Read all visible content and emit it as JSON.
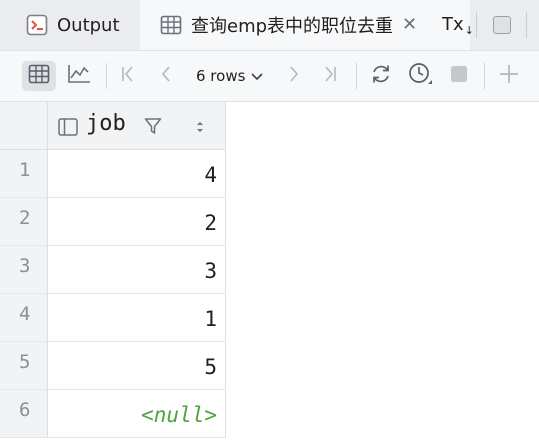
{
  "tabs": [
    {
      "label": "Output",
      "icon": "output-console-icon"
    },
    {
      "label": "查询emp表中的职位去重",
      "icon": "table-grid-icon",
      "active": true
    },
    {
      "label": "Tx",
      "sub": "↓",
      "icon": "transaction-icon"
    }
  ],
  "toolbar": {
    "rows_label": "6 rows",
    "buttons": [
      "grid-view-icon",
      "chart-view-icon",
      "first-page-icon",
      "prev-page-icon",
      "rows-dropdown",
      "next-page-icon",
      "last-page-icon",
      "refresh-icon",
      "history-clock-icon",
      "stop-icon",
      "add-row-icon"
    ]
  },
  "table": {
    "column": "job",
    "rows": [
      {
        "num": "1",
        "value": "4"
      },
      {
        "num": "2",
        "value": "2"
      },
      {
        "num": "3",
        "value": "3"
      },
      {
        "num": "4",
        "value": "1"
      },
      {
        "num": "5",
        "value": "5"
      },
      {
        "num": "6",
        "value": "<null>",
        "is_null": true
      }
    ]
  },
  "colors": {
    "tabbar_bg": "#ebecf0",
    "active_tab_bg": "#f7f8fa",
    "null_text": "#4ea43c",
    "grid_header_bg": "#f2f3f5"
  }
}
